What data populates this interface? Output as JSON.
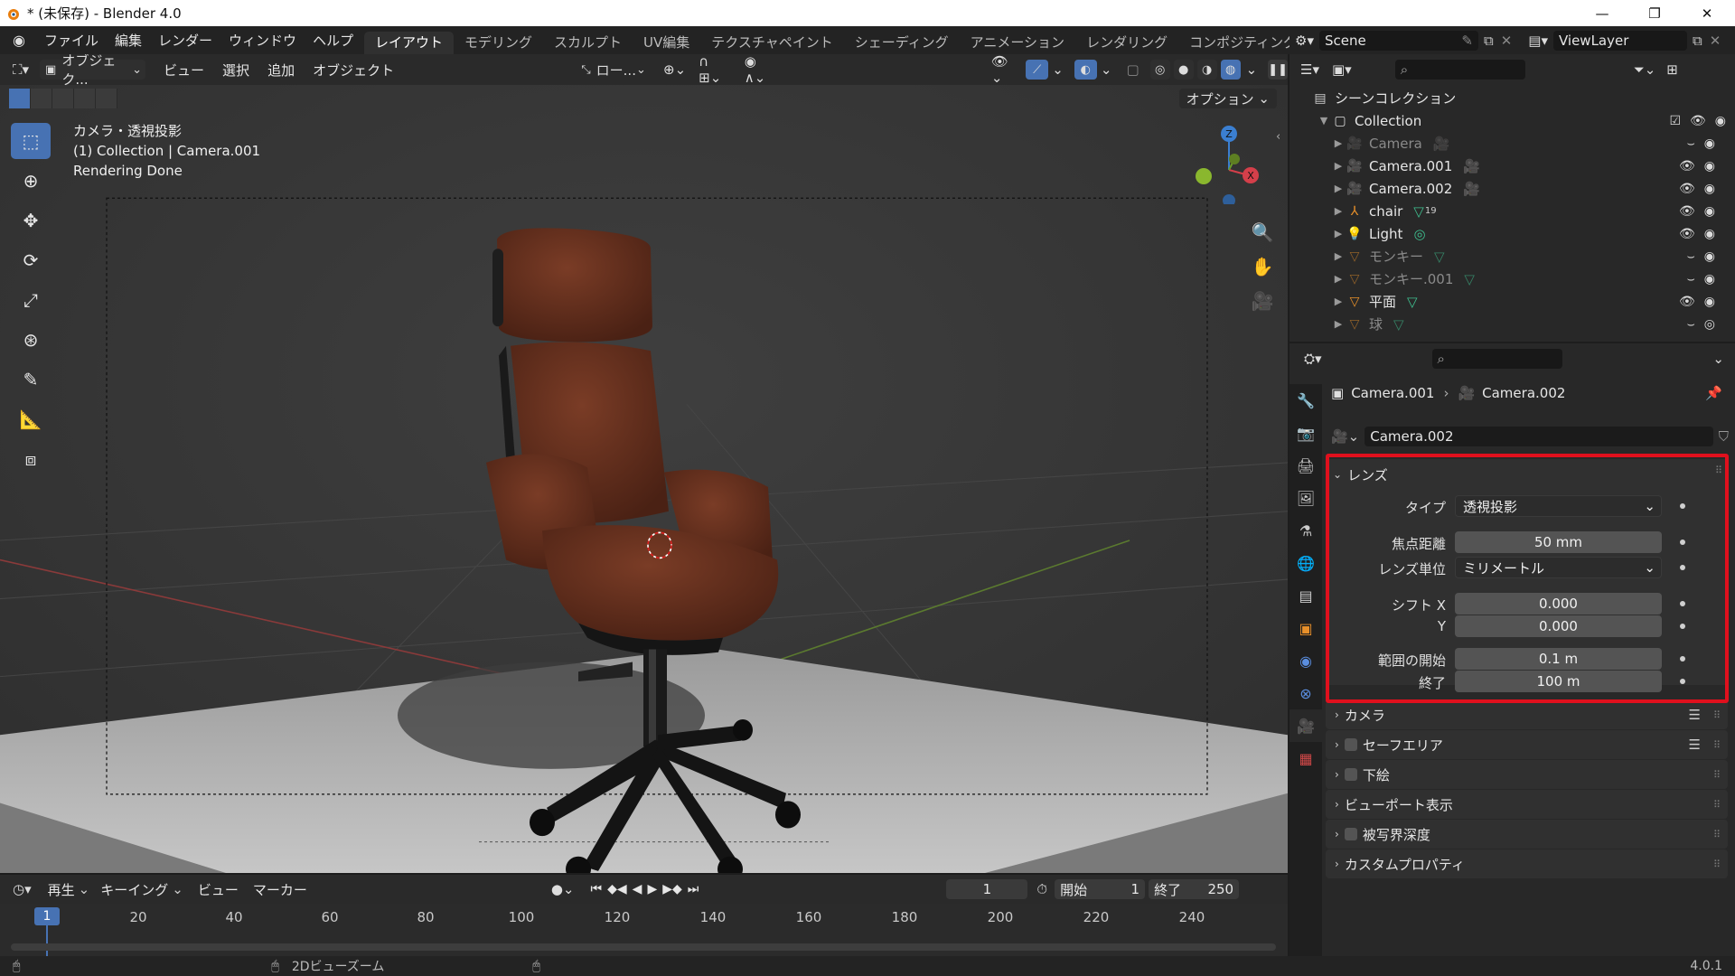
{
  "window": {
    "title": "* (未保存) - Blender 4.0",
    "minimize_icon": "minimize-icon",
    "maximize_icon": "maximize-icon",
    "close_icon": "close-icon"
  },
  "menu": [
    "ファイル",
    "編集",
    "レンダー",
    "ウィンドウ",
    "ヘルプ"
  ],
  "workspaces": [
    "レイアウト",
    "モデリング",
    "スカルプト",
    "UV編集",
    "テクスチャペイント",
    "シェーディング",
    "アニメーション",
    "レンダリング",
    "コンポジティング"
  ],
  "active_workspace": "レイアウト",
  "scene_name": "Scene",
  "view_layer": "ViewLayer",
  "viewport": {
    "mode": "オブジェク...",
    "menus": [
      "ビュー",
      "選択",
      "追加",
      "オブジェクト"
    ],
    "transform_orientation": "ロー...",
    "options_label": "オプション",
    "info_line1": "カメラ・透視投影",
    "info_line2": "(1) Collection | Camera.001",
    "info_line3": "Rendering Done",
    "gizmo_axes": [
      "Z",
      "X"
    ]
  },
  "timeline": {
    "menus": [
      "再生",
      "キーイング",
      "ビュー",
      "マーカー"
    ],
    "current_frame": "1",
    "start_label": "開始",
    "start": "1",
    "end_label": "終了",
    "end": "250",
    "ticks": [
      "1",
      "20",
      "40",
      "60",
      "80",
      "100",
      "120",
      "140",
      "160",
      "180",
      "200",
      "220",
      "240"
    ]
  },
  "outliner": {
    "root": "シーンコレクション",
    "collection": "Collection",
    "items": [
      {
        "name": "Camera",
        "dim": true,
        "icon": "camera-object-icon",
        "data_icon": "camera-data-icon",
        "count": ""
      },
      {
        "name": "Camera.001",
        "dim": false,
        "icon": "camera-object-icon",
        "data_icon": "camera-data-icon",
        "count": ""
      },
      {
        "name": "Camera.002",
        "dim": false,
        "icon": "camera-object-icon",
        "data_icon": "camera-data-icon",
        "count": ""
      },
      {
        "name": "chair",
        "dim": false,
        "icon": "empty-object-icon",
        "data_icon": "mesh-data-icon",
        "count": "19"
      },
      {
        "name": "Light",
        "dim": false,
        "icon": "light-object-icon",
        "data_icon": "light-data-icon",
        "count": ""
      },
      {
        "name": "モンキー",
        "dim": true,
        "icon": "mesh-object-icon",
        "data_icon": "mesh-data-icon",
        "count": ""
      },
      {
        "name": "モンキー.001",
        "dim": true,
        "icon": "mesh-object-icon",
        "data_icon": "mesh-data-icon",
        "count": ""
      },
      {
        "name": "平面",
        "dim": false,
        "icon": "mesh-object-icon",
        "data_icon": "mesh-data-icon",
        "count": ""
      },
      {
        "name": "球",
        "dim": true,
        "icon": "mesh-object-icon",
        "data_icon": "mesh-data-icon",
        "count": ""
      }
    ]
  },
  "properties": {
    "breadcrumb_object": "Camera.001",
    "breadcrumb_data": "Camera.002",
    "datablock": "Camera.002",
    "lens_panel": "レンズ",
    "type_label": "タイプ",
    "type_value": "透視投影",
    "focal_label": "焦点距離",
    "focal_value": "50 mm",
    "lens_unit_label": "レンズ単位",
    "lens_unit_value": "ミリメートル",
    "shift_x_label": "シフト X",
    "shift_x_value": "0.000",
    "shift_y_label": "Y",
    "shift_y_value": "0.000",
    "clip_start_label": "範囲の開始",
    "clip_start_value": "0.1 m",
    "clip_end_label": "終了",
    "clip_end_value": "100 m",
    "subpanels": [
      "カメラ",
      "セーフエリア",
      "下絵",
      "ビューポート表示",
      "被写界深度",
      "カスタムプロパティ"
    ]
  },
  "status": {
    "hint": "2Dビューズーム",
    "version": "4.0.1"
  },
  "colors": {
    "accent": "#4772b3",
    "highlight": "#e0101d",
    "chair": "#6b3320"
  }
}
